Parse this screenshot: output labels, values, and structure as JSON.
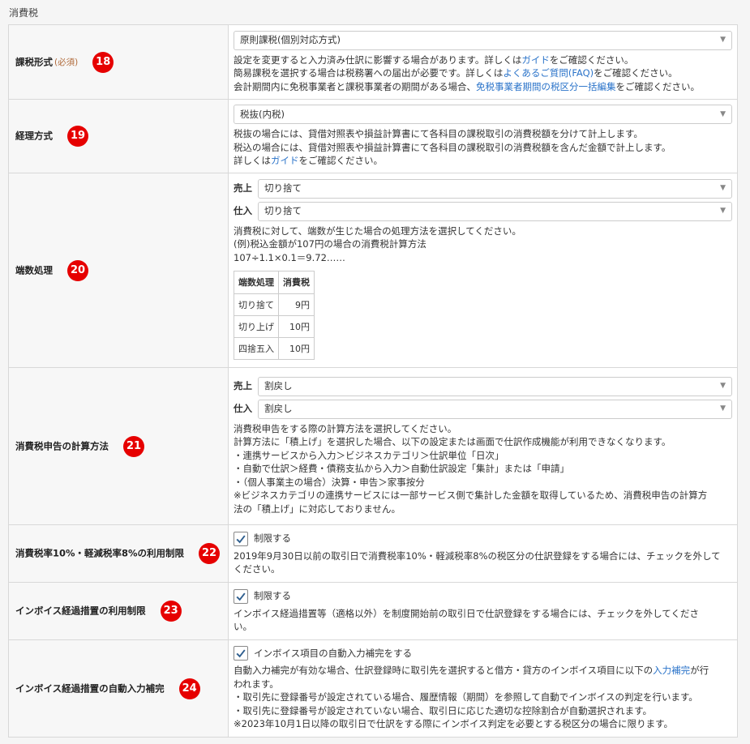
{
  "section_title": "消費税",
  "rows": {
    "tax_form": {
      "label": "課税形式",
      "required": "(必須)",
      "badge": "18",
      "select_value": "原則課税(個別対応方式)",
      "help1": "設定を変更すると入力済み仕訳に影響する場合があります。詳しくは",
      "help1_link": "ガイド",
      "help1_end": "をご確認ください。",
      "help2": "簡易課税を選択する場合は税務署への届出が必要です。詳しくは",
      "help2_link": "よくあるご質問(FAQ)",
      "help2_end": "をご確認ください。",
      "help3": "会計期間内に免税事業者と課税事業者の期間がある場合、",
      "help3_link": "免税事業者期間の税区分一括編集",
      "help3_end": "をご確認ください。"
    },
    "accounting_method": {
      "label": "経理方式",
      "badge": "19",
      "select_value": "税抜(内税)",
      "help1": "税抜の場合には、貸借対照表や損益計算書にて各科目の課税取引の消費税額を分けて計上します。",
      "help2": "税込の場合には、貸借対照表や損益計算書にて各科目の課税取引の消費税額を含んだ金額で計上します。",
      "help3": "詳しくは",
      "help3_link": "ガイド",
      "help3_end": "をご確認ください。"
    },
    "rounding": {
      "label": "端数処理",
      "badge": "20",
      "sales_label": "売上",
      "sales_value": "切り捨て",
      "purchase_label": "仕入",
      "purchase_value": "切り捨て",
      "help1": "消費税に対して、端数が生じた場合の処理方法を選択してください。",
      "help2": "(例)税込金額が107円の場合の消費税計算方法",
      "help3": "107÷1.1×0.1＝9.72……",
      "table_headers": [
        "端数処理",
        "消費税"
      ],
      "table_rows": [
        [
          "切り捨て",
          "9円"
        ],
        [
          "切り上げ",
          "10円"
        ],
        [
          "四捨五入",
          "10円"
        ]
      ]
    },
    "calc_method": {
      "label": "消費税申告の計算方法",
      "badge": "21",
      "sales_label": "売上",
      "sales_value": "割戻し",
      "purchase_label": "仕入",
      "purchase_value": "割戻し",
      "help1": "消費税申告をする際の計算方法を選択してください。",
      "help2": "計算方法に「積上げ」を選択した場合、以下の設定または画面で仕訳作成機能が利用できなくなります。",
      "help3": "・連携サービスから入力＞ビジネスカテゴリ＞仕訳単位「日次」",
      "help4": "・自動で仕訳＞経費・債務支払から入力＞自動仕訳設定「集計」または「申請」",
      "help5": "・（個人事業主の場合）決算・申告＞家事按分",
      "help6": "※ビジネスカテゴリの連携サービスには一部サービス側で集計した金額を取得しているため、消費税申告の計算方",
      "help7": "法の「積上げ」に対応しておりません。"
    },
    "rate_limit": {
      "label": "消費税率10%・軽減税率8%の利用制限",
      "badge": "22",
      "check_label": "制限する",
      "help1": "2019年9月30日以前の取引日で消費税率10%・軽減税率8%の税区分の仕訳登録をする場合には、チェックを外して",
      "help2": "ください。"
    },
    "invoice_limit": {
      "label": "インボイス経過措置の利用制限",
      "badge": "23",
      "check_label": "制限する",
      "help1": "インボイス経過措置等（適格以外）を制度開始前の取引日で仕訳登録をする場合には、チェックを外してくださ",
      "help2": "い。"
    },
    "invoice_auto": {
      "label": "インボイス経過措置の自動入力補完",
      "badge": "24",
      "check_label": "インボイス項目の自動入力補完をする",
      "help1": "自動入力補完が有効な場合、仕訳登録時に取引先を選択すると借方・貸方のインボイス項目に以下の",
      "help1_link": "入力補完",
      "help1_end": "が行",
      "help2": "われます。",
      "help3": "・取引先に登録番号が設定されている場合、履歴情報（期間）を参照して自動でインボイスの判定を行います。",
      "help4": "・取引先に登録番号が設定されていない場合、取引日に応じた適切な控除割合が自動選択されます。",
      "help5": "※2023年10月1日以降の取引日で仕訳をする際にインボイス判定を必要とする税区分の場合に限ります。"
    }
  }
}
